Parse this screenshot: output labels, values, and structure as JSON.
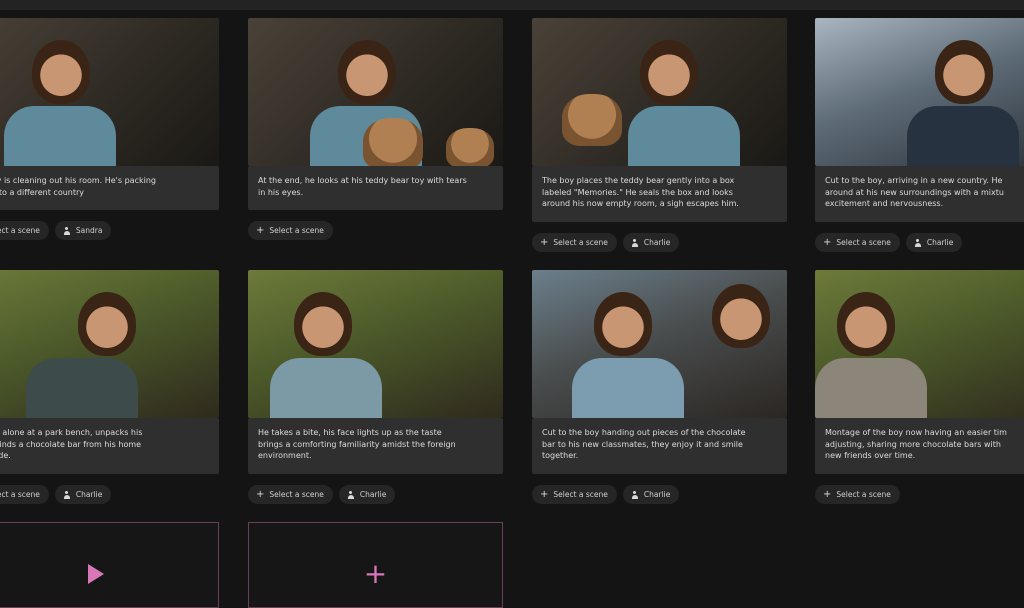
{
  "actions": {
    "select_scene_label": "Select a scene"
  },
  "scenes": [
    {
      "caption": "ng boy is cleaning out his room. He's packing\nmove to a different country",
      "character": "Sandra"
    },
    {
      "caption": "At the end, he looks at his teddy bear toy with tears\nin his eyes.",
      "character": ""
    },
    {
      "caption": "The boy places the teddy bear gently into a box\nlabeled \"Memories.\" He seals the box and looks\naround his now empty room, a sigh escapes him.",
      "character": "Charlie"
    },
    {
      "caption": "Cut to the boy, arriving in a new country. He\naround at his new surroundings with a mixtu\nexcitement and nervousness.",
      "character": "Charlie"
    },
    {
      "caption": "oy sits alone at a park bench, unpacks his\n, and finds a chocolate bar from his home\nry inside.",
      "character": "Charlie"
    },
    {
      "caption": "He takes a bite, his face lights up as the taste\nbrings a comforting familiarity amidst the foreign\nenvironment.",
      "character": "Charlie"
    },
    {
      "caption": "Cut to the boy handing out pieces of the chocolate\nbar to his new classmates, they enjoy it and smile\ntogether.",
      "character": "Charlie"
    },
    {
      "caption": "Montage of the boy now having an easier tim\nadjusting, sharing more chocolate bars with\nnew friends over time.",
      "character": ""
    }
  ],
  "icons": {
    "plus": "+",
    "person": "person-icon",
    "play": "play-icon",
    "accent": "#d978b8"
  }
}
